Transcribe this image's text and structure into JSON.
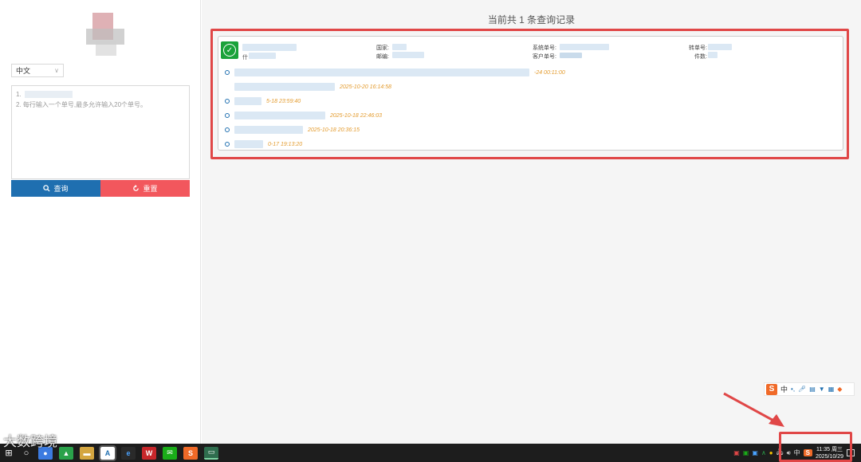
{
  "left": {
    "language": "中文",
    "textarea_line1": "1.",
    "textarea_line2": "2. 每行输入一个单号,最多允许输入20个单号。",
    "search_label": "查询",
    "reset_label": "重置"
  },
  "main": {
    "result_title": "当前共 1 条查询记录",
    "fields": {
      "country": "国家:",
      "postcode": "邮编:",
      "system_no": "系统单号:",
      "customer_no": "客户单号:",
      "transfer_no": "转单号:",
      "pieces": "件数:",
      "prefix_small": "什"
    },
    "timeline": [
      {
        "time": "-24 00:11:00"
      },
      {
        "time": "2025-10-20 16:14:58"
      },
      {
        "time": "5-18 23:59:40"
      },
      {
        "time": "2025-10-18 22:46:03"
      },
      {
        "time": "2025-10-18 20:36:15"
      },
      {
        "time": "0-17 19:13:20"
      }
    ]
  },
  "ime": {
    "logo": "S",
    "mode": "中"
  },
  "taskbar": {
    "tray_ime": "中",
    "tray_s": "S",
    "time": "11:35 周三",
    "date": "2025/10/29"
  },
  "watermark": "大数跨境",
  "colors": {
    "search_btn": "#1f6fb0",
    "reset_btn": "#f2575d",
    "highlight": "#e04747",
    "timestamp": "#e39b2e",
    "success": "#1aa23a"
  }
}
